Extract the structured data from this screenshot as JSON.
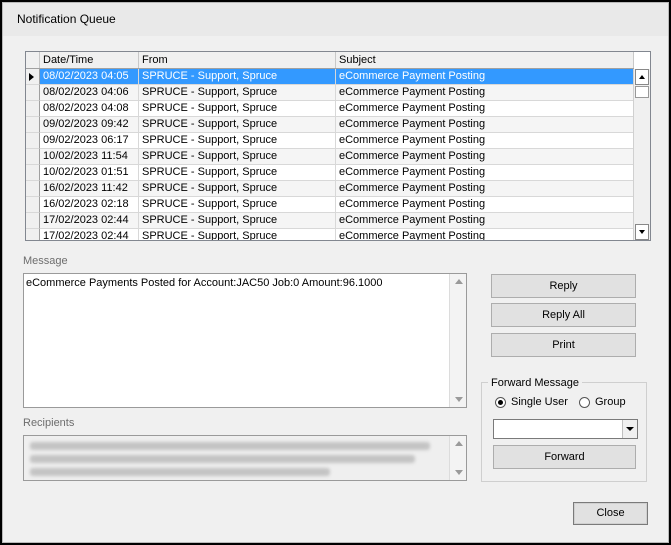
{
  "window": {
    "title": "Notification Queue"
  },
  "grid": {
    "columns": [
      "Date/Time",
      "From",
      "Subject"
    ],
    "selected_index": 0,
    "rows": [
      {
        "datetime": "08/02/2023 04:05",
        "from": "SPRUCE - Support, Spruce",
        "subject": "eCommerce Payment Posting"
      },
      {
        "datetime": "08/02/2023 04:06",
        "from": "SPRUCE - Support, Spruce",
        "subject": "eCommerce Payment Posting"
      },
      {
        "datetime": "08/02/2023 04:08",
        "from": "SPRUCE - Support, Spruce",
        "subject": "eCommerce Payment Posting"
      },
      {
        "datetime": "09/02/2023 09:42",
        "from": "SPRUCE - Support, Spruce",
        "subject": "eCommerce Payment Posting"
      },
      {
        "datetime": "09/02/2023 06:17",
        "from": "SPRUCE - Support, Spruce",
        "subject": "eCommerce Payment Posting"
      },
      {
        "datetime": "10/02/2023 11:54",
        "from": "SPRUCE - Support, Spruce",
        "subject": "eCommerce Payment Posting"
      },
      {
        "datetime": "10/02/2023 01:51",
        "from": "SPRUCE - Support, Spruce",
        "subject": "eCommerce Payment Posting"
      },
      {
        "datetime": "16/02/2023 11:42",
        "from": "SPRUCE - Support, Spruce",
        "subject": "eCommerce Payment Posting"
      },
      {
        "datetime": "16/02/2023 02:18",
        "from": "SPRUCE - Support, Spruce",
        "subject": "eCommerce Payment Posting"
      },
      {
        "datetime": "17/02/2023 02:44",
        "from": "SPRUCE - Support, Spruce",
        "subject": "eCommerce Payment Posting"
      },
      {
        "datetime": "17/02/2023 02:44",
        "from": "SPRUCE - Support, Spruce",
        "subject": "eCommerce Payment Posting"
      }
    ]
  },
  "message": {
    "label": "Message",
    "text": "eCommerce Payments Posted for Account:JAC50 Job:0 Amount:96.1000"
  },
  "recipients": {
    "label": "Recipients"
  },
  "actions": {
    "reply": "Reply",
    "reply_all": "Reply All",
    "print": "Print"
  },
  "forward": {
    "group_title": "Forward Message",
    "single_user": "Single User",
    "group": "Group",
    "selected": "Single User",
    "button": "Forward"
  },
  "close": "Close",
  "icons": {
    "selected_row": "row-pointer-icon",
    "dropdown": "chevron-down-icon",
    "scroll_up": "scroll-up-icon",
    "scroll_down": "scroll-down-icon"
  },
  "colors": {
    "selection": "#3399ff",
    "window": "#f0f0f0"
  }
}
